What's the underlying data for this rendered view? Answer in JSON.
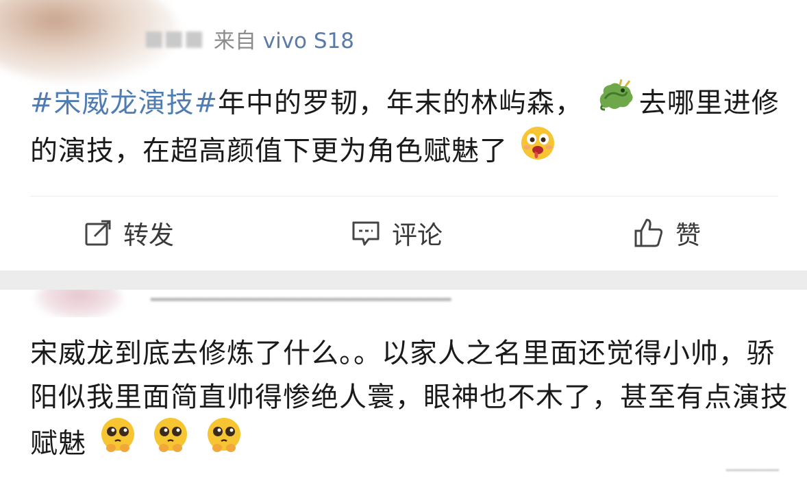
{
  "post": {
    "source_prefix": "来自",
    "source_device": "vivo S18",
    "hashtag": "#宋威龙演技#",
    "text_line1": "年中的罗韧，年末的林屿森，",
    "text_line2_a": "去哪",
    "text_line2_b": "里进修的演技，在超高颜值下更为角色赋魅了",
    "emoji_dragon": "dragon-emoji",
    "emoji_end": "drooling-face-emoji"
  },
  "actions": {
    "repost_label": "转发",
    "comment_label": "评论",
    "like_label": "赞"
  },
  "comment": {
    "text": "宋威龙到底去修炼了什么。。以家人之名里面还觉得小帅，骄阳似我里面简直帅得惨绝人寰，眼神也不木了，甚至有点演技赋魅",
    "emojis": [
      "pleading-face-emoji",
      "pleading-face-emoji",
      "pleading-face-emoji"
    ]
  },
  "colors": {
    "hashtag": "#4f7db3",
    "separator_band": "#ececec",
    "text": "#1a1a1a"
  }
}
